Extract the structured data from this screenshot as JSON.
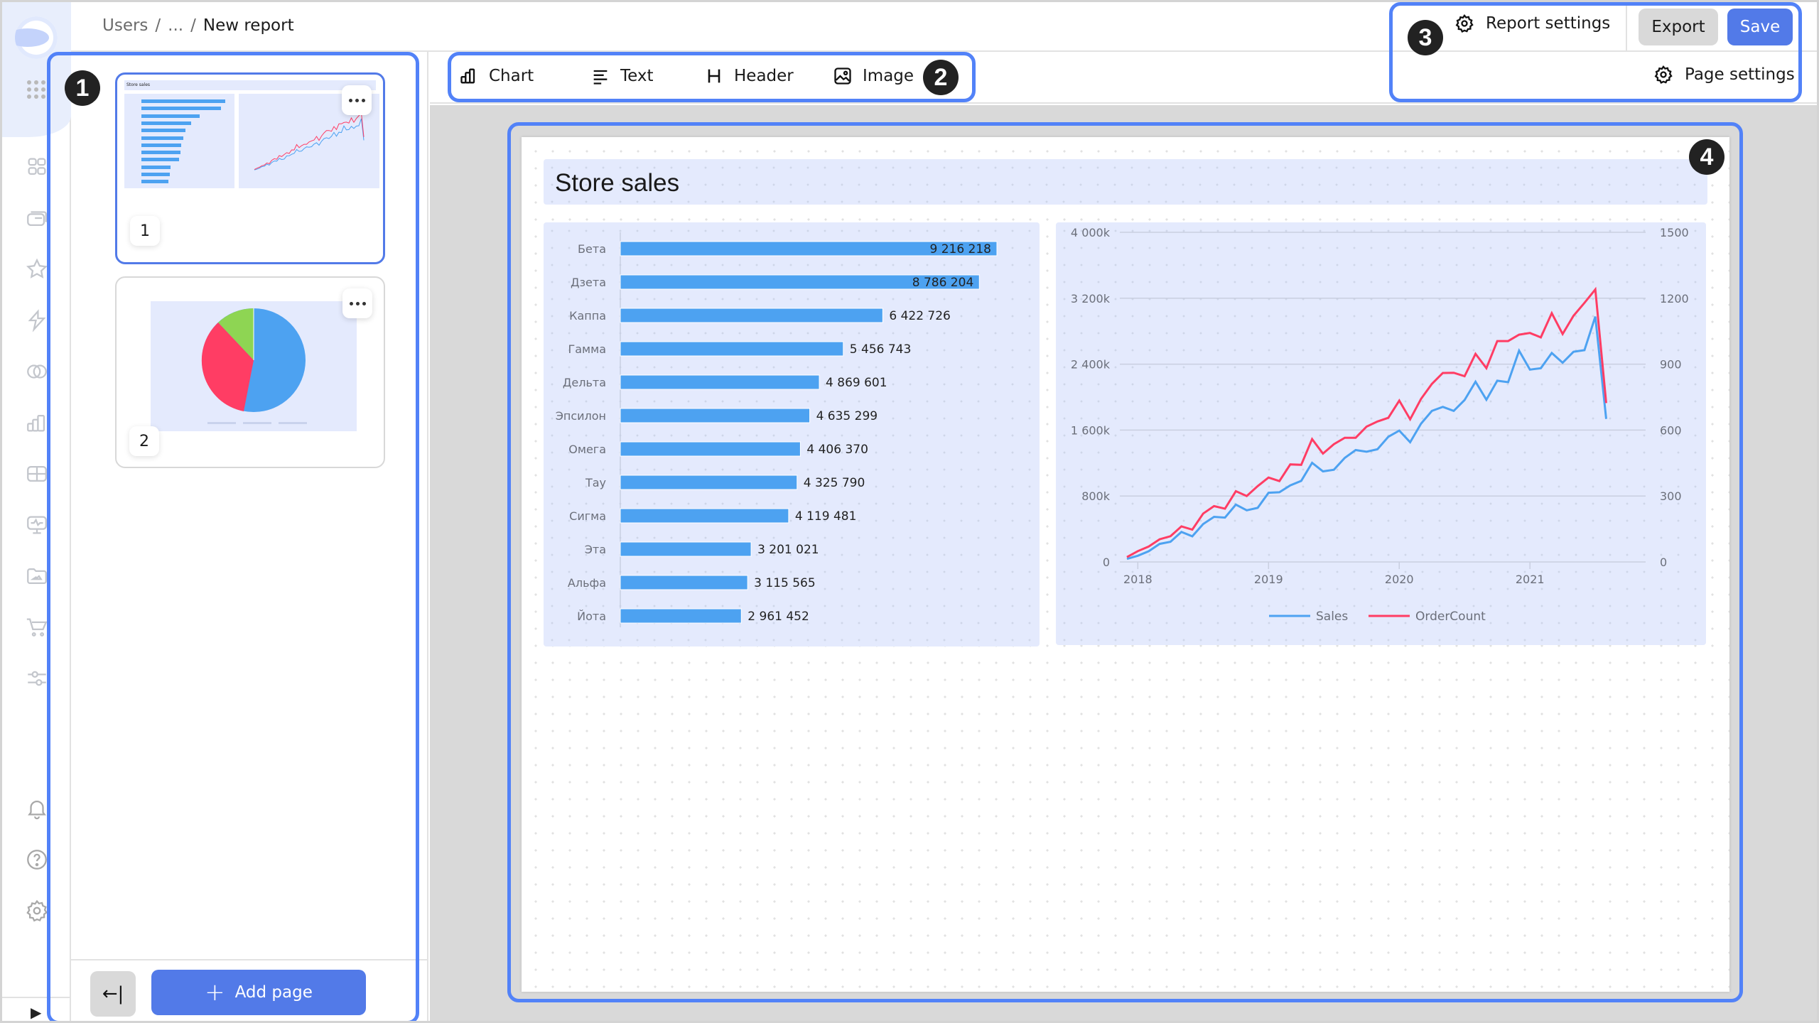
{
  "header": {
    "breadcrumb": [
      "Users",
      "/",
      "...",
      "/"
    ],
    "current_page": "New report",
    "report_settings_label": "Report settings",
    "export_label": "Export",
    "save_label": "Save"
  },
  "nav_rail": {
    "icons": [
      "dashboards-icon",
      "collections-icon",
      "favorites-icon",
      "connections-icon",
      "datasets-icon",
      "charts-icon",
      "ql-charts-icon",
      "monitoring-icon",
      "files-icon",
      "marketplace-icon",
      "settings-sliders-icon"
    ],
    "bottom_icons": [
      "notifications-icon",
      "help-icon",
      "settings-icon"
    ]
  },
  "pages_panel": {
    "pages": [
      {
        "number": "1",
        "title": "Store sales",
        "active": true
      },
      {
        "number": "2",
        "active": false
      }
    ],
    "add_page_label": "Add page",
    "collapse_label": "←|"
  },
  "toolbar": {
    "items": [
      {
        "label": "Chart",
        "icon": "chart-icon"
      },
      {
        "label": "Text",
        "icon": "text-icon"
      },
      {
        "label": "Header",
        "icon": "header-icon"
      },
      {
        "label": "Image",
        "icon": "image-icon"
      }
    ],
    "page_settings_label": "Page settings"
  },
  "annotations": [
    "1",
    "2",
    "3",
    "4"
  ],
  "report": {
    "title": "Store sales"
  },
  "colors": {
    "accent": "#527ae8",
    "bar": "#4da2f1",
    "sales_line": "#4da2f1",
    "order_line": "#ff3d64",
    "widget_bg": "#e4eafd"
  },
  "chart_data": [
    {
      "type": "bar",
      "orientation": "horizontal",
      "categories": [
        "Бета",
        "Дзета",
        "Каппа",
        "Гамма",
        "Дельта",
        "Эпсилон",
        "Омега",
        "Тау",
        "Сигма",
        "Эта",
        "Альфа",
        "Йота"
      ],
      "values": [
        9216218,
        8786204,
        6422726,
        5456743,
        4869601,
        4635299,
        4406370,
        4325790,
        4119481,
        3201021,
        3115565,
        2961452
      ],
      "value_labels": [
        "9 216 218",
        "8 786 204",
        "6 422 726",
        "5 456 743",
        "4 869 601",
        "4 635 299",
        "4 406 370",
        "4 325 790",
        "4 119 481",
        "3 201 021",
        "3 115 565",
        "2 961 452"
      ],
      "title": "",
      "xlabel": "",
      "ylabel": ""
    },
    {
      "type": "line",
      "title": "",
      "x_ticks": [
        "2018",
        "2019",
        "2020",
        "2021"
      ],
      "x_start": "2017-12",
      "x_step": "month",
      "y_left": {
        "ticks": [
          "0",
          "800k",
          "1 600k",
          "2 400k",
          "3 200k",
          "4 000k"
        ],
        "range": [
          0,
          4000
        ]
      },
      "y_right": {
        "ticks": [
          "0",
          "300",
          "600",
          "900",
          "1200",
          "1500"
        ],
        "range": [
          0,
          1500
        ]
      },
      "grid": true,
      "legend_position": "bottom",
      "series": [
        {
          "name": "Sales",
          "axis": "left",
          "unit": "k",
          "values": [
            37,
            75,
            130,
            219,
            245,
            365,
            311,
            460,
            547,
            538,
            696,
            627,
            656,
            840,
            846,
            929,
            984,
            1203,
            1099,
            1119,
            1263,
            1358,
            1338,
            1367,
            1519,
            1594,
            1453,
            1678,
            1833,
            1882,
            1833,
            1965,
            2187,
            1968,
            2199,
            2181,
            2564,
            2334,
            2351,
            2535,
            2417,
            2550,
            2570,
            2978,
            1735
          ]
        },
        {
          "name": "OrderCount",
          "axis": "right",
          "values": [
            22,
            49,
            70,
            103,
            117,
            162,
            147,
            220,
            254,
            242,
            322,
            300,
            345,
            384,
            368,
            444,
            442,
            559,
            493,
            536,
            565,
            565,
            616,
            639,
            656,
            734,
            649,
            742,
            810,
            860,
            861,
            845,
            947,
            882,
            1005,
            1005,
            1034,
            1042,
            1022,
            1132,
            1037,
            1120,
            1179,
            1240,
            723
          ]
        }
      ]
    }
  ]
}
